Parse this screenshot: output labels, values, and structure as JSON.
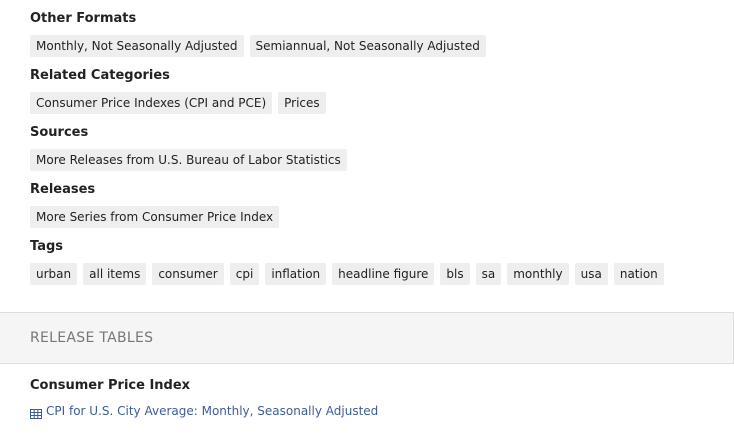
{
  "other_formats": {
    "heading": "Other Formats",
    "items": [
      "Monthly, Not Seasonally Adjusted",
      "Semiannual, Not Seasonally Adjusted"
    ]
  },
  "related_categories": {
    "heading": "Related Categories",
    "items": [
      "Consumer Price Indexes (CPI and PCE)",
      "Prices"
    ]
  },
  "sources": {
    "heading": "Sources",
    "items": [
      "More Releases from U.S. Bureau of Labor Statistics"
    ]
  },
  "releases": {
    "heading": "Releases",
    "items": [
      "More Series from Consumer Price Index"
    ]
  },
  "tags": {
    "heading": "Tags",
    "items": [
      "urban",
      "all items",
      "consumer",
      "cpi",
      "inflation",
      "headline figure",
      "bls",
      "sa",
      "monthly",
      "usa",
      "nation"
    ]
  },
  "release_tables": {
    "panel_title": "RELEASE TABLES",
    "group_heading": "Consumer Price Index",
    "link_label": "CPI for U.S. City Average: Monthly, Seasonally Adjusted",
    "link_icon": "table-icon",
    "link_color": "#3b5d9c"
  }
}
